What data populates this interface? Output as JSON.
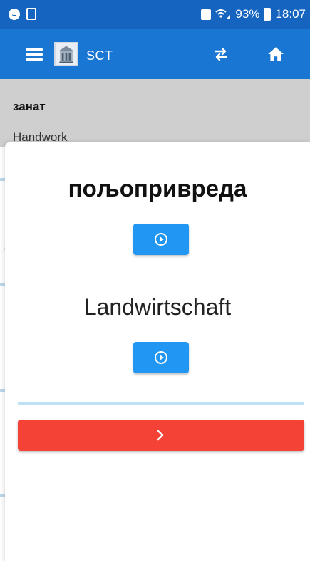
{
  "status_bar": {
    "battery": "93%",
    "time": "18:07",
    "icons": [
      "notification-circle-icon",
      "document-icon",
      "lock-icon",
      "wifi-signal-icon",
      "battery-icon"
    ]
  },
  "app_bar": {
    "title": "SCT",
    "icons": [
      "menu-icon",
      "app-logo",
      "swap-icon",
      "home-icon"
    ],
    "color": "#1976d2"
  },
  "background": {
    "header_title": "занат",
    "header_subtitle": "Handwork"
  },
  "card": {
    "source_word": "пољопривреда",
    "target_word": "Landwirtschaft",
    "play_button_color": "#2196f3",
    "next_button_color": "#f44336",
    "next_icon": "chevron-right-icon"
  }
}
